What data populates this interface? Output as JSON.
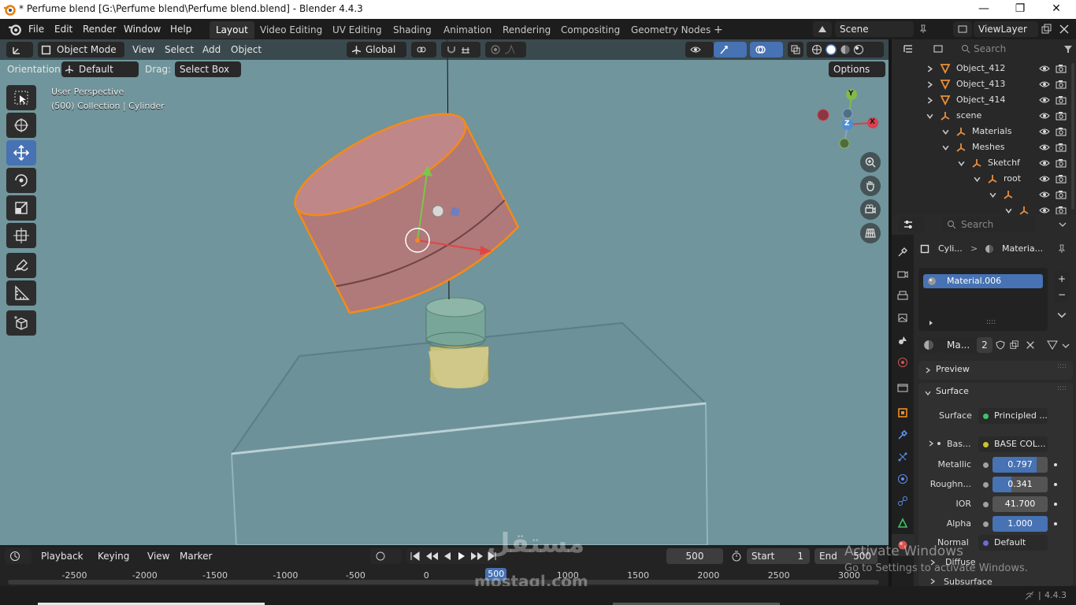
{
  "window": {
    "title": "* Perfume blend [G:\\Perfume blend\\Perfume blend.blend] - Blender 4.4.3",
    "minimize": "—",
    "maximize": "❐",
    "close": "✕"
  },
  "menu": [
    "File",
    "Edit",
    "Render",
    "Window",
    "Help"
  ],
  "workspaces": [
    "Layout",
    "Video Editing",
    "UV Editing",
    "Shading",
    "Animation",
    "Rendering",
    "Compositing",
    "Geometry Nodes"
  ],
  "workspace_add": "+",
  "scene": {
    "name": "Scene",
    "view_layer": "ViewLayer"
  },
  "viewport_header": {
    "mode": "Object Mode",
    "menus": [
      "View",
      "Select",
      "Add",
      "Object"
    ],
    "transform_orientation": "Global",
    "orientation_label": "Orientation:",
    "orientation_value": "Default",
    "drag_label": "Drag:",
    "drag_value": "Select Box",
    "options": "Options"
  },
  "viewport": {
    "info_line1": "User Perspective",
    "info_line2": "(500) Collection | Cylinder",
    "bg_color": "#70959c",
    "gizmo_labels": {
      "y": "Y",
      "z": "Z",
      "x": "X"
    }
  },
  "outliner": {
    "search_placeholder": "Search",
    "rows": [
      {
        "name": "Object_412",
        "indent": 0,
        "icon": "mesh-icon"
      },
      {
        "name": "Object_413",
        "indent": 0,
        "icon": "mesh-icon"
      },
      {
        "name": "Object_414",
        "indent": 0,
        "icon": "mesh-icon"
      },
      {
        "name": "scene",
        "indent": 0,
        "icon": "empty-icon"
      },
      {
        "name": "Materials",
        "indent": 1,
        "icon": "empty-icon"
      },
      {
        "name": "Meshes",
        "indent": 1,
        "icon": "empty-icon"
      },
      {
        "name": "Sketchf",
        "indent": 2,
        "icon": "empty-icon"
      },
      {
        "name": "root",
        "indent": 3,
        "icon": "empty-icon"
      },
      {
        "name": "",
        "indent": 4,
        "icon": "empty-icon"
      },
      {
        "name": "",
        "indent": 5,
        "icon": "empty-icon"
      }
    ]
  },
  "properties": {
    "search_placeholder": "Search",
    "breadcrumb_object": "Cyli...",
    "breadcrumb_material": "Materia...",
    "material_slot": "Material.006",
    "material_short": "Ma...",
    "users": "2",
    "panels": {
      "preview": "Preview",
      "surface": "Surface"
    },
    "surface_label": "Surface",
    "surface_value": "Principled ...",
    "base_color_label": "Bas...",
    "base_color_value": "BASE COL...",
    "fields": [
      {
        "label": "Metallic",
        "value": "0.797",
        "fill": 0.797
      },
      {
        "label": "Roughn...",
        "value": "0.341",
        "fill": 0.341
      },
      {
        "label": "IOR",
        "value": "41.700",
        "fill": 0
      },
      {
        "label": "Alpha",
        "value": "1.000",
        "fill": 1.0
      }
    ],
    "normal_label": "Normal",
    "normal_value": "Default",
    "diffuse": "Diffuse",
    "subsurface": "Subsurface"
  },
  "timeline": {
    "menus": [
      "Playback",
      "Keying",
      "View",
      "Marker"
    ],
    "current_frame": "500",
    "start_label": "Start",
    "start_value": "1",
    "end_label": "End",
    "end_value": "500",
    "ticks": [
      "-2500",
      "-2000",
      "-1500",
      "-1000",
      "-500",
      "0",
      "500",
      "1000",
      "1500",
      "2000",
      "2500",
      "3000"
    ],
    "playhead": "500"
  },
  "watermark": {
    "activate_title": "Activate Windows",
    "activate_sub": "Go to Settings to activate Windows.",
    "site": "mostaql.com",
    "site_ar": "مستقل"
  },
  "status": {
    "version": "4.4.3"
  }
}
